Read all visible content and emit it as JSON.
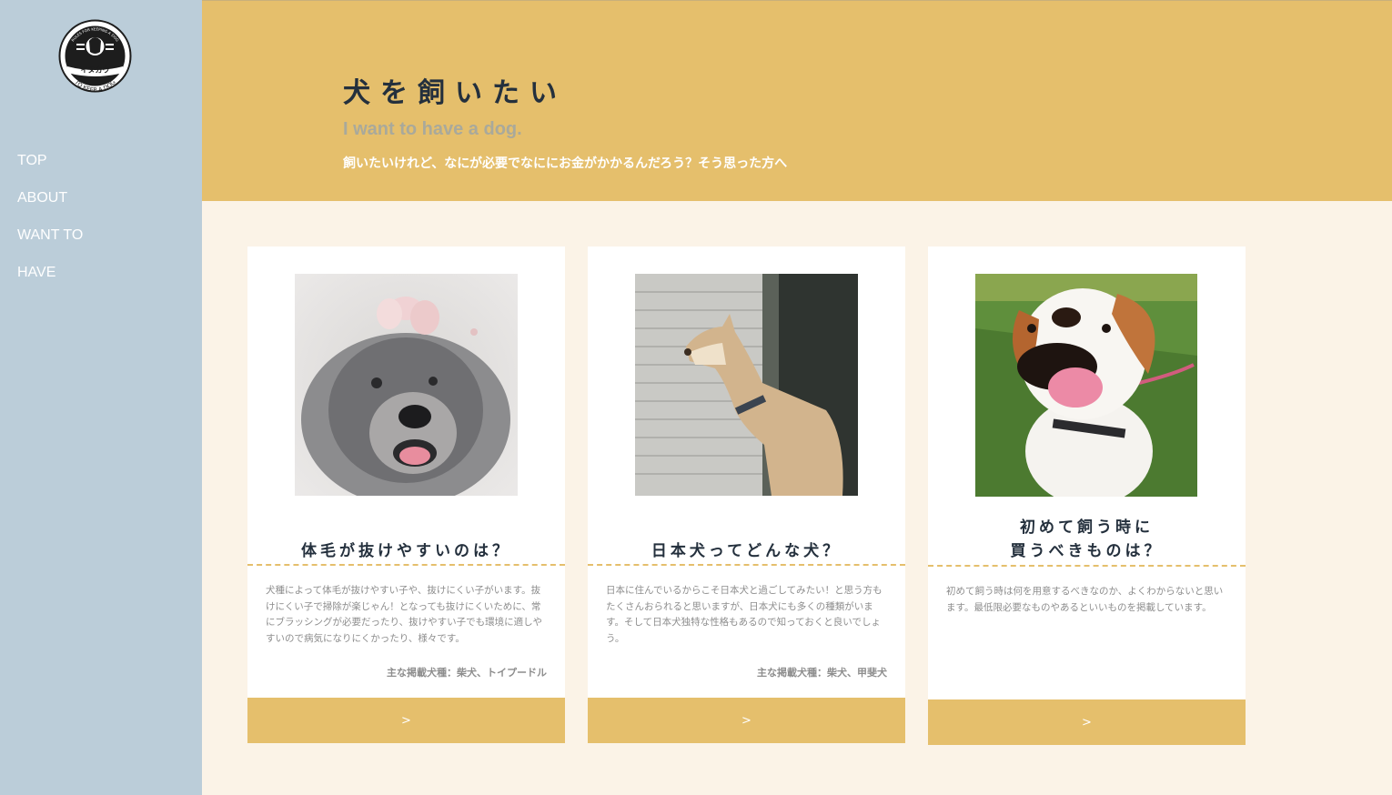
{
  "sidebar": {
    "logo": {
      "text_top": "RULES FOR KEEPING A DOG",
      "text_main": "イヌカウ",
      "text_bottom": "TO KEEP A DOG"
    },
    "nav": [
      {
        "label": "TOP"
      },
      {
        "label": "ABOUT"
      },
      {
        "label": "WANT TO"
      },
      {
        "label": "HAVE"
      }
    ]
  },
  "hero": {
    "title": "犬を飼いたい",
    "subtitle_en": "I want to have a dog.",
    "description": "飼いたいけれど、なにが必要でなににお金がかかるんだろう？そう思った方へ"
  },
  "cards": [
    {
      "image_icon": "poodle-photo",
      "title_lines": [
        "体毛が抜けやすいのは？"
      ],
      "body": "犬種によって体毛が抜けやすい子や、抜けにくい子がいます。抜けにくい子で掃除が楽じゃん！となっても抜けにくいために、常にブラッシングが必要だったり、抜けやすい子でも環境に適しやすいので病気になりにくかったり、様々です。",
      "breeds": "主な掲載犬種：柴犬、トイプードル",
      "button": ">"
    },
    {
      "image_icon": "shiba-photo",
      "title_lines": [
        "日本犬ってどんな犬？"
      ],
      "body": "日本に住んでいるからこそ日本犬と過ごしてみたい！と思う方もたくさんおられると思いますが、日本犬にも多くの種類がいます。そして日本犬独特な性格もあるので知っておくと良いでしょう。",
      "breeds": "主な掲載犬種：柴犬、甲斐犬",
      "button": ">"
    },
    {
      "image_icon": "jack-russell-photo",
      "title_lines": [
        "初めて飼う時に",
        "買うべきものは？"
      ],
      "body": "初めて飼う時は何を用意するべきなのか、よくわからないと思います。最低限必要なものやあるといいものを掲載しています。",
      "breeds": "",
      "button": ">"
    }
  ],
  "colors": {
    "sidebar": "#bbcdd9",
    "accent": "#e5bf6c",
    "background": "#fbf3e7",
    "heading": "#24303d"
  }
}
